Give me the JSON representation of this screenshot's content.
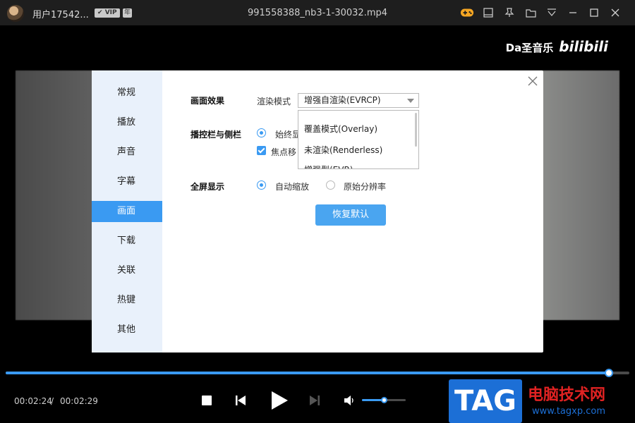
{
  "titlebar": {
    "username": "用户17542...",
    "vip_badge": "VIP",
    "year_badge": "年",
    "file_title": "991558388_nb3-1-30032.mp4",
    "icons": [
      "gamepad-icon",
      "panel-icon",
      "pin-icon",
      "folder-icon",
      "menu-icon",
      "minimize-icon",
      "maximize-icon",
      "close-icon"
    ],
    "game_icon_color": "#f5a623"
  },
  "video": {
    "watermark_text": "Da圣音乐",
    "logo_text": "bilibili"
  },
  "settings": {
    "nav": [
      {
        "label": "常规",
        "active": false
      },
      {
        "label": "播放",
        "active": false
      },
      {
        "label": "声音",
        "active": false
      },
      {
        "label": "字幕",
        "active": false
      },
      {
        "label": "画面",
        "active": true
      },
      {
        "label": "下载",
        "active": false
      },
      {
        "label": "关联",
        "active": false
      },
      {
        "label": "热键",
        "active": false
      },
      {
        "label": "其他",
        "active": false
      }
    ],
    "picture_effect": {
      "label": "画面效果",
      "render_mode_label": "渲染模式",
      "selected": "增强自渲染(EVRCP)",
      "options": [
        "覆盖模式(Overlay)",
        "未渲染(Renderless)",
        "增强型(EVR)"
      ]
    },
    "controlbar": {
      "label": "播控栏与侧栏",
      "option1": "始终显",
      "option2": "焦点移"
    },
    "fullscreen": {
      "label": "全屏显示",
      "auto_zoom": "自动缩放",
      "original": "原始分辨率",
      "selected": "auto_zoom"
    },
    "reset_button": "恢复默认"
  },
  "player": {
    "current_time": "00:02:24",
    "separator": "/",
    "total_time": "00:02:29",
    "progress": 0.967,
    "volume": 0.5,
    "accent_color": "#3a9af2"
  },
  "site_watermark": {
    "tag": "TAG",
    "name": "电脑技术网",
    "url": "www.tagxp.com"
  }
}
